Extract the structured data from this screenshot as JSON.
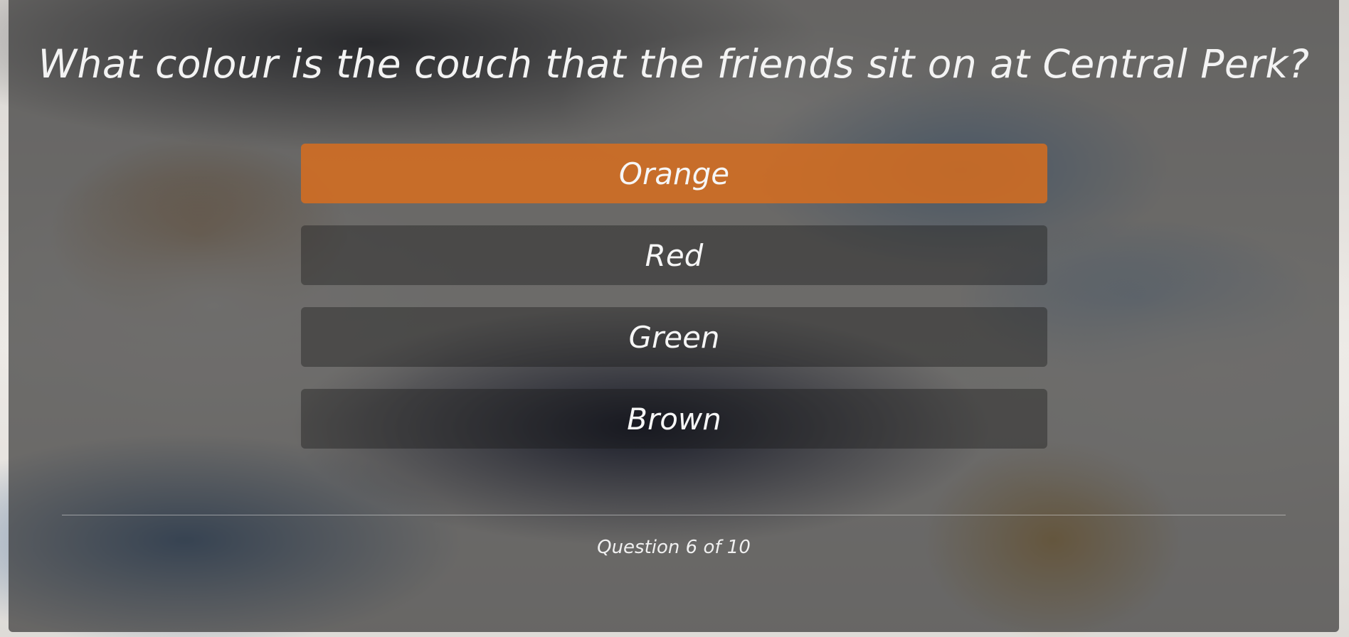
{
  "quiz": {
    "question": "What colour is the couch that the friends sit on at Central Perk?",
    "answers": [
      {
        "label": "Orange",
        "selected": true
      },
      {
        "label": "Red",
        "selected": false
      },
      {
        "label": "Green",
        "selected": false
      },
      {
        "label": "Brown",
        "selected": false
      }
    ],
    "progress": "Question 6 of 10"
  },
  "colors": {
    "selected_answer": "#dc6e1c",
    "panel_overlay": "#1e1e1e",
    "text": "#f3f3f3"
  }
}
